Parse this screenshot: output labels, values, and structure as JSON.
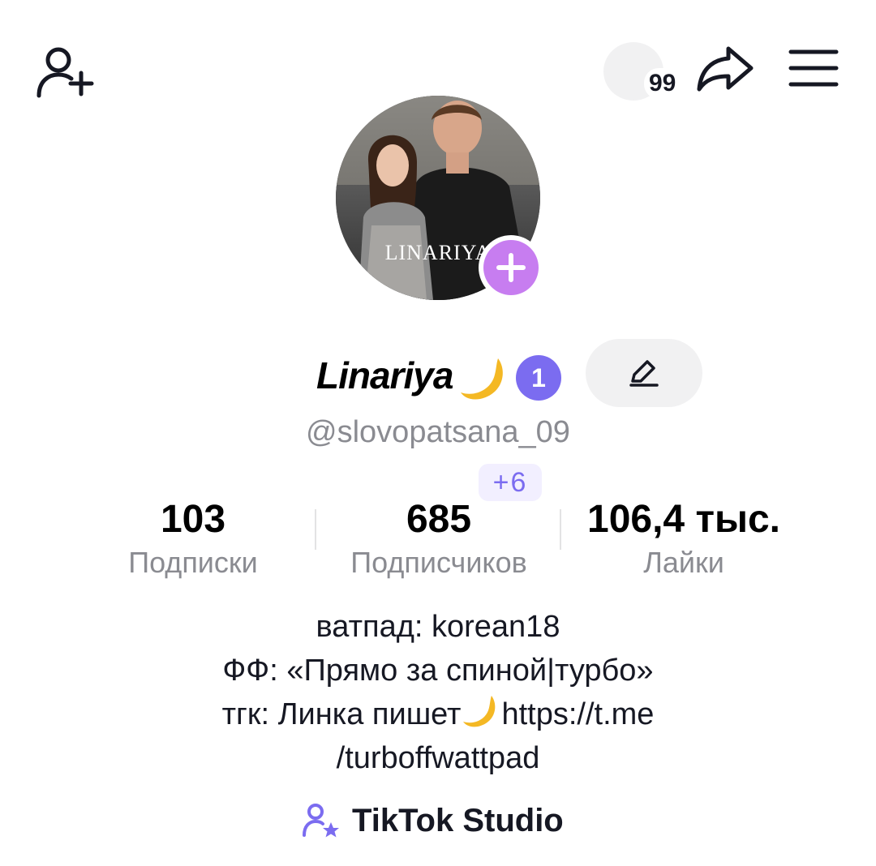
{
  "topbar": {
    "notifications_count": "99"
  },
  "avatar": {
    "overlay_text": "LINARIYA"
  },
  "profile": {
    "display_name": "Linariya",
    "level": "1",
    "username": "@slovopatsana_09"
  },
  "stats": {
    "following": {
      "value": "103",
      "label": "Подписки"
    },
    "followers": {
      "value": "685",
      "label": "Подписчиков",
      "new_badge": "+6"
    },
    "likes": {
      "value": "106,4 тыс.",
      "label": "Лайки"
    }
  },
  "bio": {
    "line1": "ватпад: korean18",
    "line2": "ФФ: «Прямо за спиной|турбо»",
    "line3_before_icon": "тгк: Линка пишет",
    "line3_after_icon": "https://t.me",
    "line4": "/turboffwattpad"
  },
  "studio": {
    "label": "TikTok Studio"
  },
  "colors": {
    "accent_purple": "#7b6cf0",
    "avatar_add": "#c77df0",
    "muted_text": "#8a8b91",
    "pill_bg": "#f1f1f2"
  },
  "icons": [
    "add-friend-icon",
    "notification-bubble-icon",
    "share-icon",
    "menu-icon",
    "plus-icon",
    "moon-icon",
    "edit-pencil-icon",
    "creator-star-icon"
  ]
}
